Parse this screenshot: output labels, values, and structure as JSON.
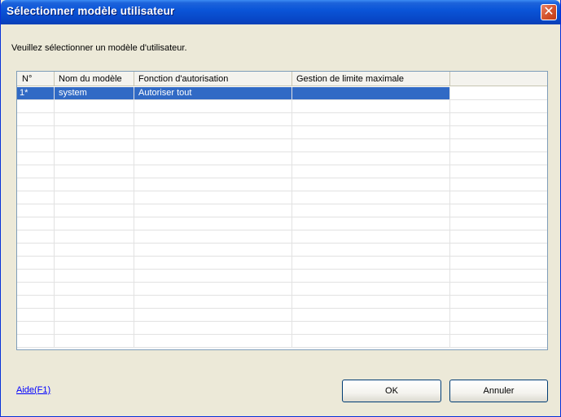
{
  "window": {
    "title": "Sélectionner modèle utilisateur",
    "close_label": "✕"
  },
  "instruction": "Veuillez sélectionner un modèle d'utilisateur.",
  "table": {
    "columns": [
      "N°",
      "Nom du modèle",
      "Fonction d'autorisation",
      "Gestion de limite maximale"
    ],
    "rows": [
      {
        "num": "1*",
        "name": "system",
        "function": "Autoriser tout",
        "limit": ""
      }
    ],
    "selected_index": 0,
    "selection_color": "#316AC5"
  },
  "footer": {
    "help_label": "Aide(F1)",
    "ok_label": "OK",
    "cancel_label": "Annuler"
  }
}
